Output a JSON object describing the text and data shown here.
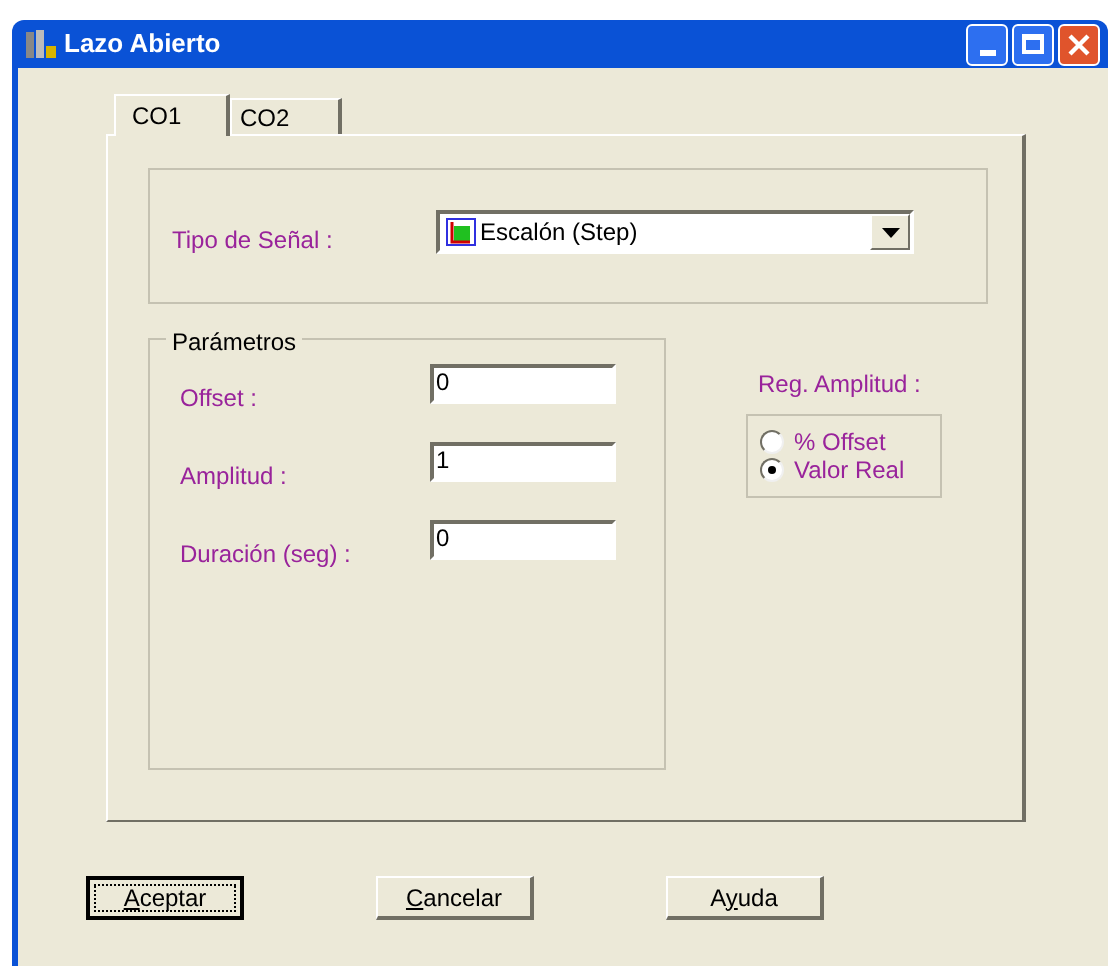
{
  "window": {
    "title": "Lazo Abierto"
  },
  "tabs": [
    {
      "label": "CO1",
      "selected": true
    },
    {
      "label": "CO2",
      "selected": false
    }
  ],
  "signal_type": {
    "label": "Tipo de Señal :",
    "value": "Escalón (Step)"
  },
  "parameters": {
    "title": "Parámetros",
    "fields": [
      {
        "label": "Offset :",
        "value": "0"
      },
      {
        "label": "Amplitud :",
        "value": "1"
      },
      {
        "label": "Duración (seg) :",
        "value": "0"
      }
    ]
  },
  "amplitude_reg": {
    "label": "Reg. Amplitud :",
    "options": [
      {
        "label": "% Offset",
        "selected": false
      },
      {
        "label": "Valor Real",
        "selected": true
      }
    ]
  },
  "buttons": [
    {
      "mnemonic": "A",
      "after": "ceptar",
      "default": true
    },
    {
      "mnemonic": "C",
      "after": "ancelar",
      "default": false
    },
    {
      "before": "A",
      "mnemonic": "y",
      "after": "uda",
      "default": false
    }
  ]
}
